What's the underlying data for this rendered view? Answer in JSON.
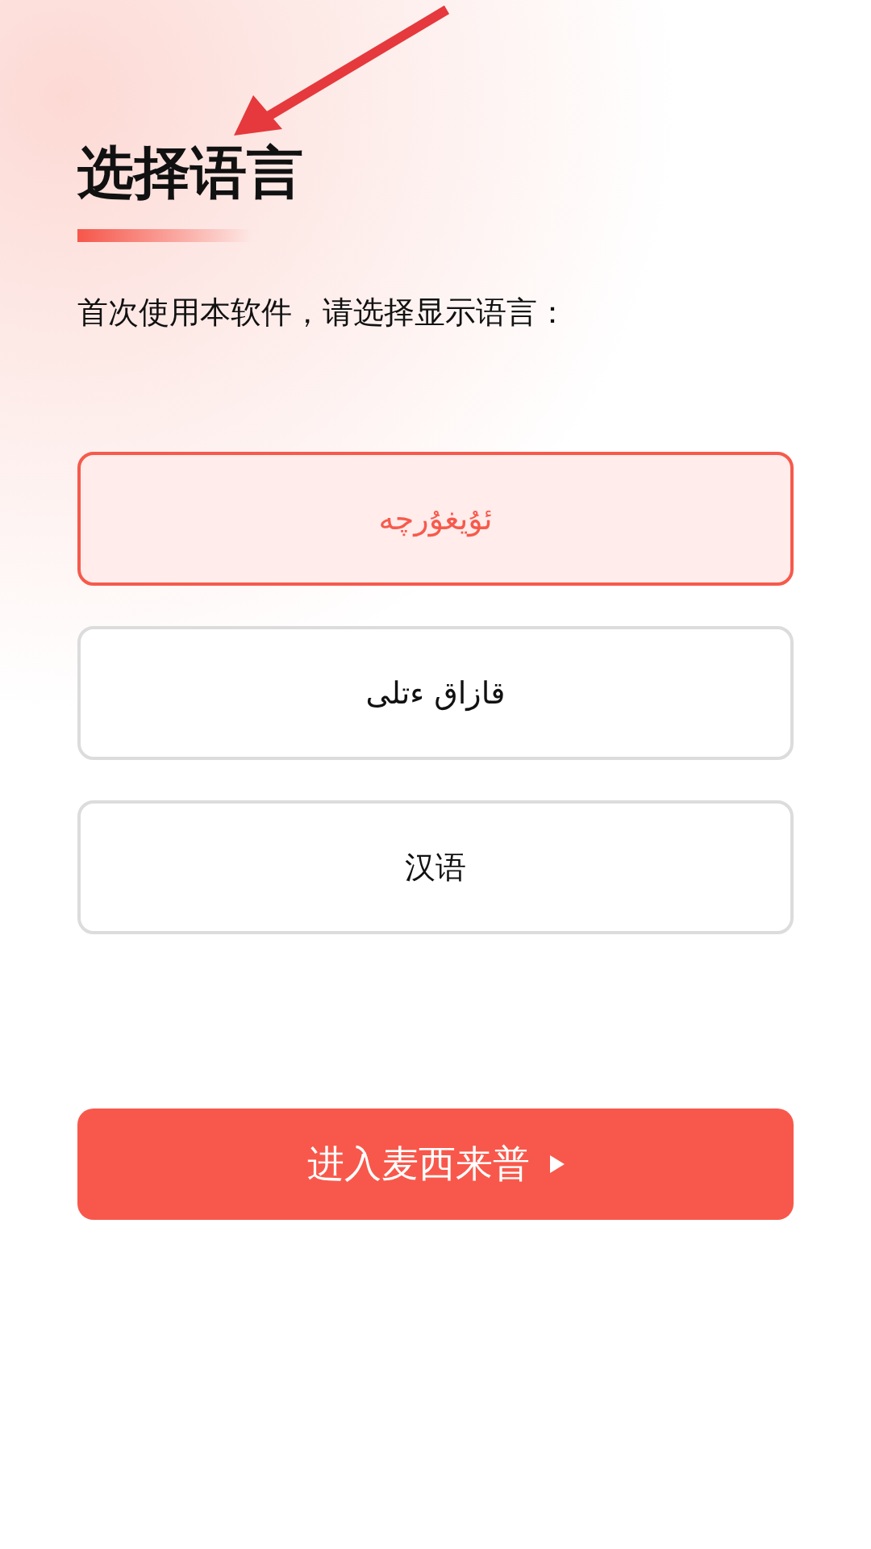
{
  "title": "选择语言",
  "prompt": "首次使用本软件，请选择显示语言：",
  "languages": [
    {
      "label": "ئۇيغۇرچە",
      "selected": true
    },
    {
      "label": "قازاق ءتلى",
      "selected": false
    },
    {
      "label": "汉语",
      "selected": false
    }
  ],
  "enter_button": {
    "label": "进入麦西来普"
  }
}
